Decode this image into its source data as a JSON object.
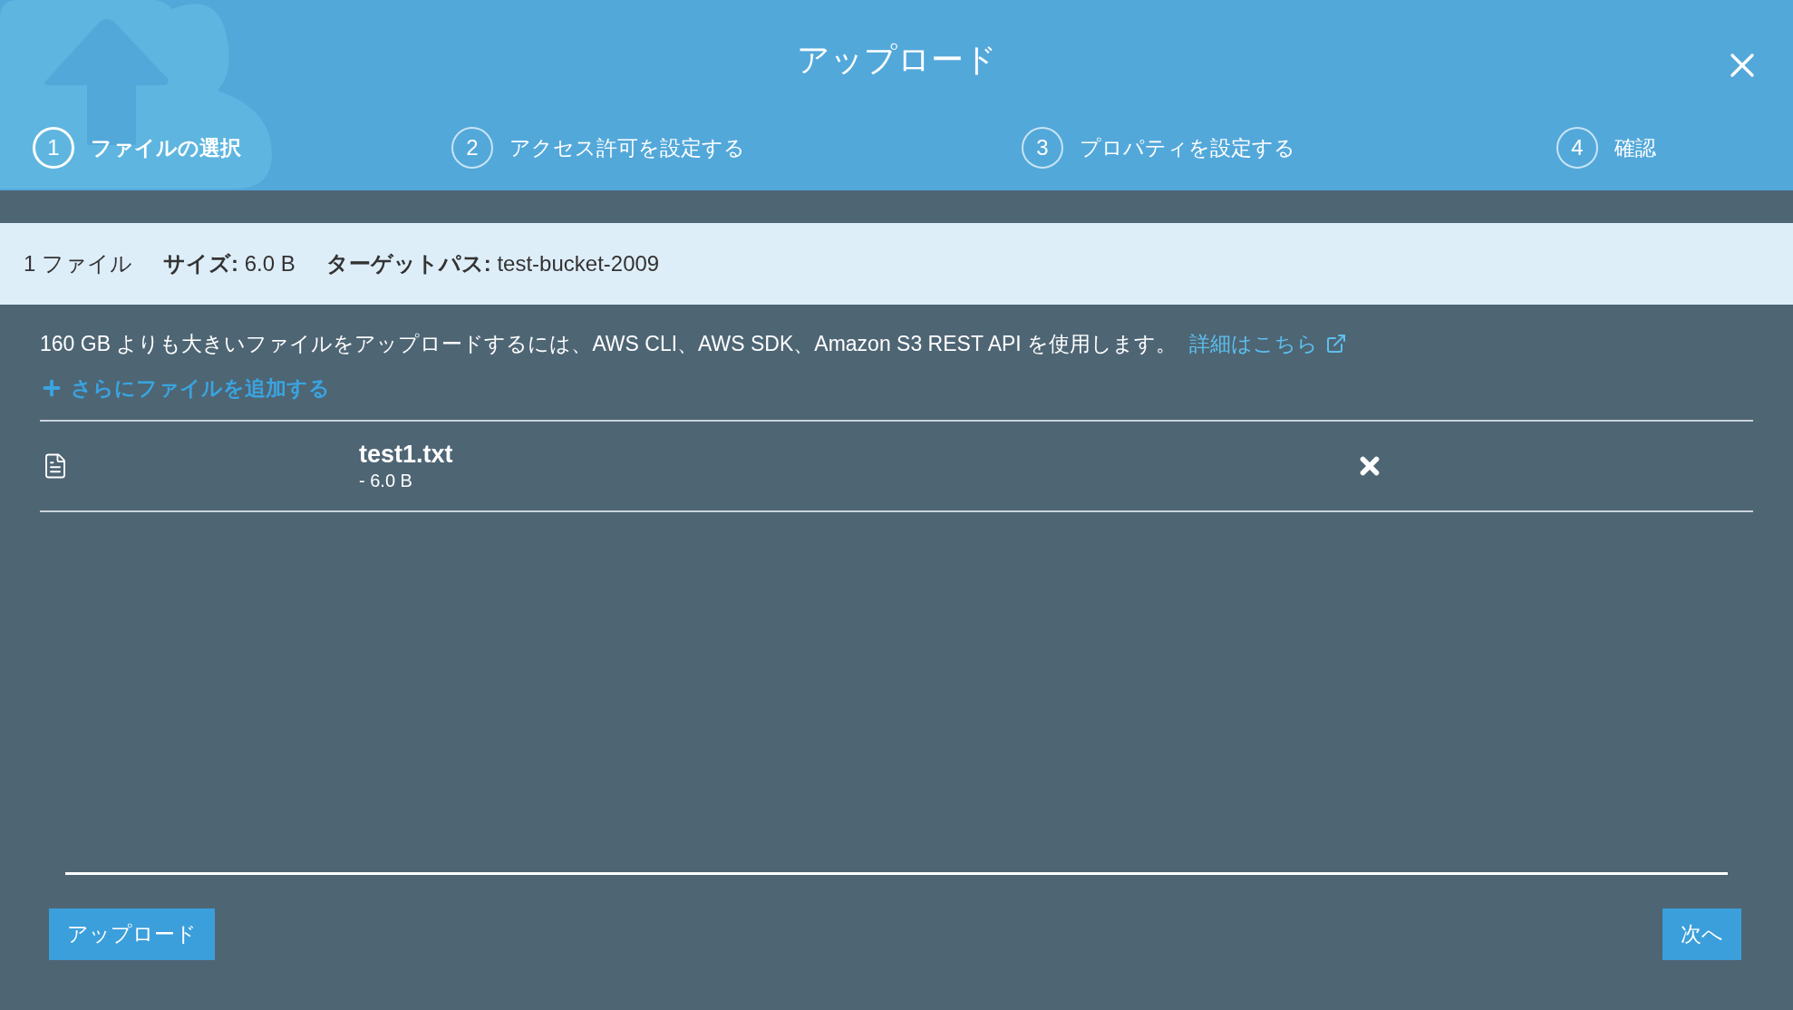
{
  "dialog": {
    "title": "アップロード"
  },
  "steps": [
    {
      "number": "1",
      "label": "ファイルの選択",
      "selected": true
    },
    {
      "number": "2",
      "label": "アクセス許可を設定する",
      "selected": false
    },
    {
      "number": "3",
      "label": "プロパティを設定する",
      "selected": false
    },
    {
      "number": "4",
      "label": "確認",
      "selected": false
    }
  ],
  "summary": {
    "file_count": "1 ファイル",
    "size_label": "サイズ:",
    "size": "6.0 B",
    "target_label": "ターゲットパス:",
    "target": "test-bucket-2009"
  },
  "notice": {
    "text": "160 GB よりも大きいファイルをアップロードするには、AWS CLI、AWS SDK、Amazon S3 REST API を使用します。",
    "link": "詳細はこちら"
  },
  "add_files": "さらにファイルを追加する",
  "files": [
    {
      "name": "test1.txt",
      "size": "- 6.0 B"
    }
  ],
  "buttons": {
    "upload": "アップロード",
    "next": "次へ"
  }
}
